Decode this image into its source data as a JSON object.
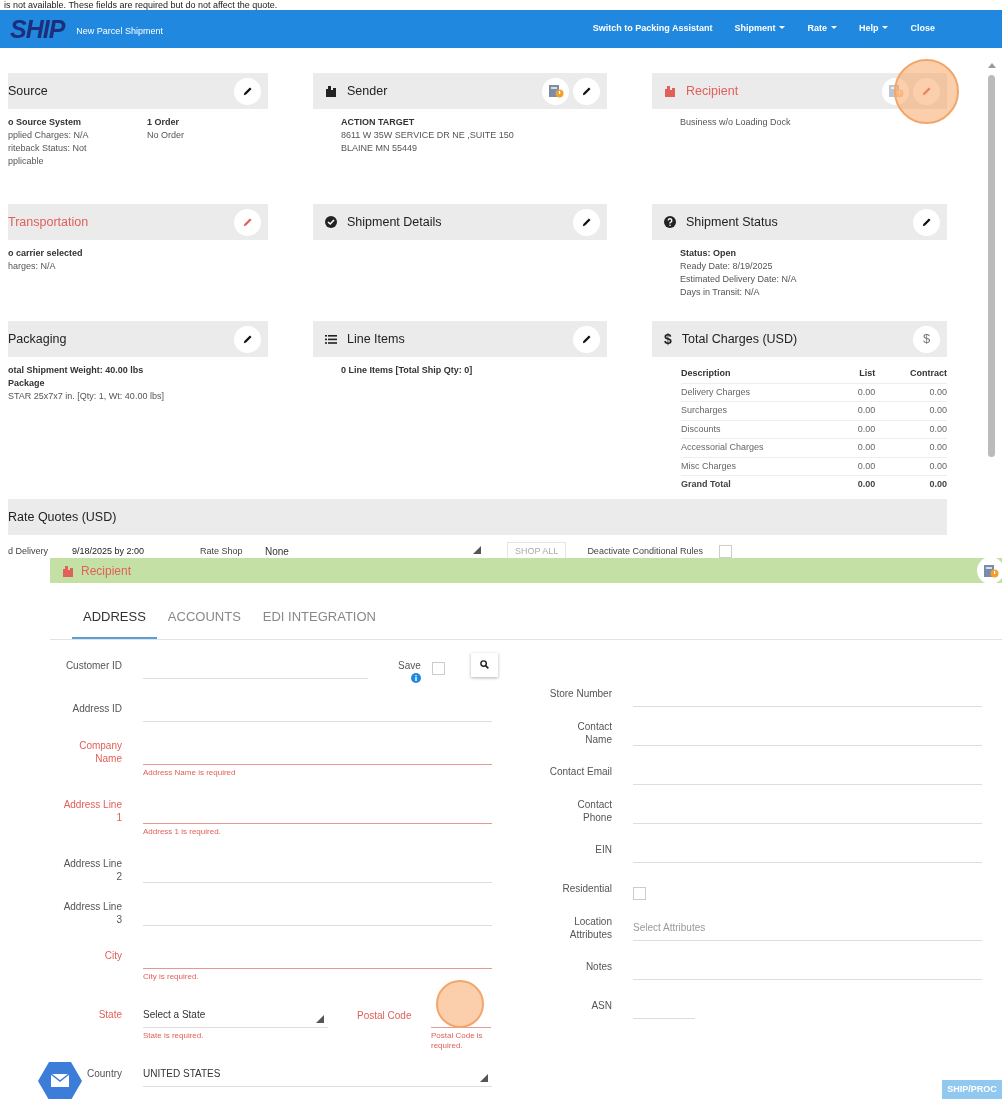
{
  "caption": "is not available. These fields are required but do not affect the quote.",
  "navbar": {
    "logo": "SHIP",
    "title": "New Parcel Shipment",
    "menu": [
      {
        "label": "Switch to Packing Assistant",
        "dropdown": false
      },
      {
        "label": "Shipment",
        "dropdown": true
      },
      {
        "label": "Rate",
        "dropdown": true
      },
      {
        "label": "Help",
        "dropdown": true
      },
      {
        "label": "Close",
        "dropdown": false
      }
    ]
  },
  "panels": [
    {
      "title": "Source",
      "kind": "plain",
      "alert": false,
      "actions": [
        {
          "kind": "edit",
          "highlighted": false
        }
      ],
      "columns": [
        [
          {
            "text": "o Source System",
            "bold": true
          },
          {
            "text": "pplied Charges: N/A",
            "bold": false
          },
          {
            "text": "riteback Status: Not",
            "bold": false
          },
          {
            "text": "pplicable",
            "bold": false
          }
        ],
        [
          {
            "text": "1 Order",
            "bold": true
          },
          {
            "text": "No Order",
            "bold": false
          }
        ]
      ]
    },
    {
      "title": "Sender",
      "kind": "building",
      "alert": false,
      "actions": [
        {
          "kind": "address-book",
          "highlighted": false
        },
        {
          "kind": "edit",
          "highlighted": false
        }
      ],
      "columns": [
        [
          {
            "text": "ACTION TARGET",
            "bold": true
          },
          {
            "text": "8611 W 35W SERVICE DR NE ,SUITE 150",
            "bold": false
          },
          {
            "text": "BLAINE MN 55449",
            "bold": false
          }
        ]
      ]
    },
    {
      "title": "Recipient",
      "kind": "building",
      "alert": true,
      "actions": [
        {
          "kind": "address-book",
          "highlighted": false
        },
        {
          "kind": "edit",
          "highlighted": true
        }
      ],
      "columns": [
        [
          {
            "text": "Business w/o Loading Dock",
            "bold": false
          }
        ]
      ]
    },
    {
      "title": "Transportation",
      "kind": "plain",
      "alert": true,
      "actions": [
        {
          "kind": "edit",
          "highlighted": false
        }
      ],
      "columns": [
        [
          {
            "text": "o carrier selected",
            "bold": true
          },
          {
            "text": "harges: N/A",
            "bold": false
          }
        ]
      ]
    },
    {
      "title": "Shipment Details",
      "kind": "check",
      "alert": false,
      "actions": [
        {
          "kind": "edit",
          "highlighted": false
        }
      ]
    },
    {
      "title": "Shipment Status",
      "kind": "question",
      "alert": false,
      "actions": [
        {
          "kind": "edit",
          "highlighted": false
        }
      ],
      "columns": [
        [
          {
            "text": "Status: Open",
            "bold": true
          },
          {
            "text": "Ready Date: 8/19/2025",
            "bold": false
          },
          {
            "text": "Estimated Delivery Date: N/A",
            "bold": false
          },
          {
            "text": "Days in Transit: N/A",
            "bold": false
          }
        ]
      ]
    },
    {
      "title": "Packaging",
      "kind": "plain",
      "alert": false,
      "actions": [
        {
          "kind": "edit",
          "highlighted": false
        }
      ],
      "columns": [
        [
          {
            "text": "otal Shipment Weight: 40.00 lbs",
            "bold": true
          },
          {
            "text": "Package",
            "bold": true
          },
          {
            "text": "STAR 25x7x7 in. [Qty: 1, Wt: 40.00 lbs]",
            "bold": false
          }
        ]
      ]
    },
    {
      "title": "Line Items",
      "kind": "list",
      "alert": false,
      "actions": [
        {
          "kind": "edit",
          "highlighted": false
        }
      ],
      "columns": [
        [
          {
            "text": "0 Line Items [Total Ship Qty: 0]",
            "bold": true
          }
        ]
      ]
    },
    {
      "title": "Total Charges (USD)",
      "kind": "charges",
      "icon_text": "$",
      "alert": false,
      "actions": [
        {
          "kind": "glyph",
          "text": "$",
          "highlighted": false
        }
      ],
      "table": {
        "columns": [
          "Description",
          "List",
          "Contract"
        ],
        "rows": [
          {
            "cells": [
              "Delivery Charges",
              "0.00",
              "0.00"
            ],
            "total": false
          },
          {
            "cells": [
              "Surcharges",
              "0.00",
              "0.00"
            ],
            "total": false
          },
          {
            "cells": [
              "Discounts",
              "0.00",
              "0.00"
            ],
            "total": false
          },
          {
            "cells": [
              "Accessorial Charges",
              "0.00",
              "0.00"
            ],
            "total": false
          },
          {
            "cells": [
              "Misc Charges",
              "0.00",
              "0.00"
            ],
            "total": false
          },
          {
            "cells": [
              "Grand Total",
              "0.00",
              "0.00"
            ],
            "total": true
          }
        ]
      }
    }
  ],
  "rate_quotes": {
    "title": "Rate Quotes (USD)",
    "delivery_label": "d Delivery",
    "delivery_value": "9/18/2025 by 2:00",
    "rate_shop_label": "Rate Shop",
    "rate_shop_value": "None",
    "shop_all": "SHOP ALL",
    "deactivate_label": "Deactivate Conditional Rules",
    "deactivate_checked": false
  },
  "dialog": {
    "title": "Recipient",
    "tabs": [
      {
        "label": "ADDRESS",
        "selected": true
      },
      {
        "label": "ACCOUNTS",
        "selected": false
      },
      {
        "label": "EDI INTEGRATION",
        "selected": false
      }
    ],
    "left_fields": [
      {
        "kind": "customer",
        "label": "Customer ID",
        "required": false,
        "save_label": "Save",
        "save_checked": false
      },
      {
        "kind": "text",
        "label": "Address ID",
        "required": false
      },
      {
        "kind": "text",
        "label": "Company Name",
        "required": true,
        "error": "Address Name is required"
      },
      {
        "kind": "text",
        "label": "Address Line 1",
        "required": true,
        "error": "Address 1 is required."
      },
      {
        "kind": "text",
        "label": "Address Line 2",
        "required": false
      },
      {
        "kind": "text",
        "label": "Address Line 3",
        "required": false
      },
      {
        "kind": "text",
        "label": "City",
        "required": true,
        "error": "City is required."
      },
      {
        "kind": "select",
        "label": "State",
        "required": true,
        "value": "Select a State",
        "error": "State is required.",
        "postal": {
          "label": "Postal Code",
          "required": true,
          "error": "Postal Code is required.",
          "highlighted": true
        }
      },
      {
        "kind": "select",
        "label": "Country",
        "required": false,
        "value": "UNITED STATES"
      }
    ],
    "right_fields": [
      {
        "kind": "text",
        "label": "Store Number",
        "required": false
      },
      {
        "kind": "text",
        "label": "Contact Name",
        "required": false
      },
      {
        "kind": "text",
        "label": "Contact Email",
        "required": false
      },
      {
        "kind": "text",
        "label": "Contact Phone",
        "required": false
      },
      {
        "kind": "text",
        "label": "EIN",
        "required": false
      },
      {
        "kind": "checkbox",
        "label": "Residential",
        "required": false,
        "checked": false
      },
      {
        "kind": "text",
        "label": "Location Attributes",
        "required": false,
        "placeholder": "Select Attributes"
      },
      {
        "kind": "text",
        "label": "Notes",
        "required": false
      },
      {
        "kind": "short",
        "label": "ASN",
        "required": false
      }
    ],
    "ship_button": "SHIP/PROC"
  }
}
